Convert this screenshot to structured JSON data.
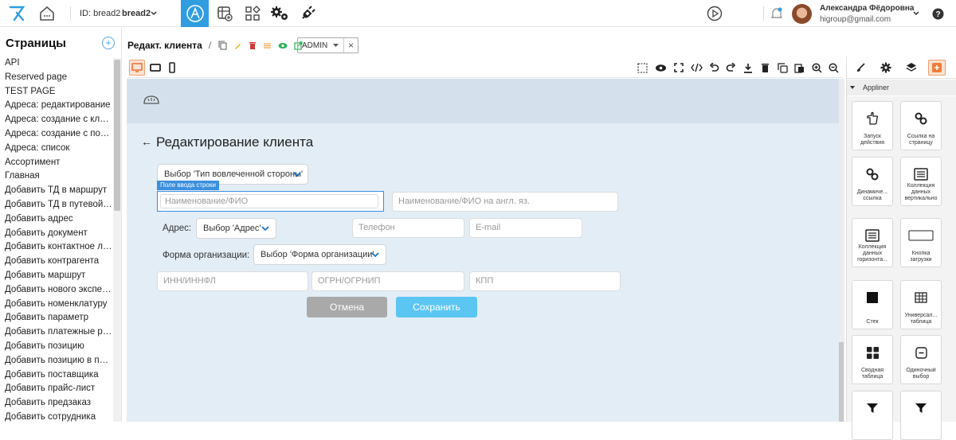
{
  "topbar": {
    "logo": "appliner-logo-icon",
    "project_id_label": "ID: bread2",
    "project_name": "bread2",
    "user_name": "Александра Фёдоровна",
    "user_email": "higroup@gmail.com",
    "accent_color": "#2f9de0",
    "icons": [
      "home-icon",
      "builder-icon",
      "table-add-icon",
      "widgets-icon",
      "gears-icon",
      "plugin-icon",
      "play-icon",
      "notification-icon",
      "avatar",
      "help-icon"
    ]
  },
  "sidebar": {
    "title": "Страницы",
    "add_icon": "+",
    "pages": [
      "API",
      "Reserved page",
      "TEST PAGE",
      "Адреса: редактирование",
      "Адреса: создание с клиента",
      "Адреса: создание с поставщика",
      "Адреса: список",
      "Ассортимент",
      "Главная",
      "Добавить ТД в маршрут",
      "Добавить ТД в путевой лист",
      "Добавить адрес",
      "Добавить документ",
      "Добавить контактное лицо",
      "Добавить контрагента",
      "Добавить маршрут",
      "Добавить нового эксперта",
      "Добавить номенклатуру",
      "Добавить параметр",
      "Добавить платежные реквизиты",
      "Добавить позицию",
      "Добавить позицию в прайс",
      "Добавить поставщика",
      "Добавить прайс-лист",
      "Добавить предзаказ",
      "Добавить сотрудника"
    ]
  },
  "editor": {
    "page_title": "Редакт. клиента",
    "separator": "/",
    "role_select": "ADMIN",
    "clear_icon": "×"
  },
  "canvas": {
    "heading": "Редактирование клиента",
    "back_arrow": "←",
    "select_party": "Выбор 'Тип вовлеченной стороны'",
    "selected_tag": "Поле ввода строки",
    "name_placeholder": "Наименование/ФИО",
    "name_en_placeholder": "Наименование/ФИО на англ. яз.",
    "address_label": "Адрес:",
    "address_select": "Выбор 'Адрес'",
    "phone_placeholder": "Телефон",
    "email_placeholder": "E-mail",
    "org_form_label": "Форма организации:",
    "org_form_select": "Выбор 'Форма организации'",
    "inn_placeholder": "ИНН/ИННФЛ",
    "ogrn_placeholder": "ОГРН/ОГРНИП",
    "kpp_placeholder": "КПП",
    "cancel_label": "Отмена",
    "save_label": "Сохранить",
    "save_color": "#5bc6f2",
    "cancel_color": "#a9a9a9"
  },
  "right_panel": {
    "group_label": "Appliner",
    "widgets": [
      {
        "label": "Запуск\nдействия",
        "icon": "hand-pointer-icon"
      },
      {
        "label": "Ссылка на\nстраницу",
        "icon": "link-icon"
      },
      {
        "label": "Динамиче...\nссылка",
        "icon": "link-icon"
      },
      {
        "label": "Коллекция\nданных\nвертикально",
        "icon": "list-icon"
      },
      {
        "label": "Коллекция\nданных\nгоризонта...",
        "icon": "list-icon"
      },
      {
        "label": "Кнопка\nзагрузки",
        "icon": "button-outline-icon"
      },
      {
        "label": "Стек",
        "icon": "square-icon"
      },
      {
        "label": "Универсал...\nтаблица",
        "icon": "table-icon"
      },
      {
        "label": "Сводная\nтаблица",
        "icon": "grid-icon"
      },
      {
        "label": "Одиночный\nвыбор",
        "icon": "minus-box-icon"
      },
      {
        "label": "",
        "icon": "filter-icon"
      },
      {
        "label": "",
        "icon": "filter-icon"
      }
    ]
  }
}
